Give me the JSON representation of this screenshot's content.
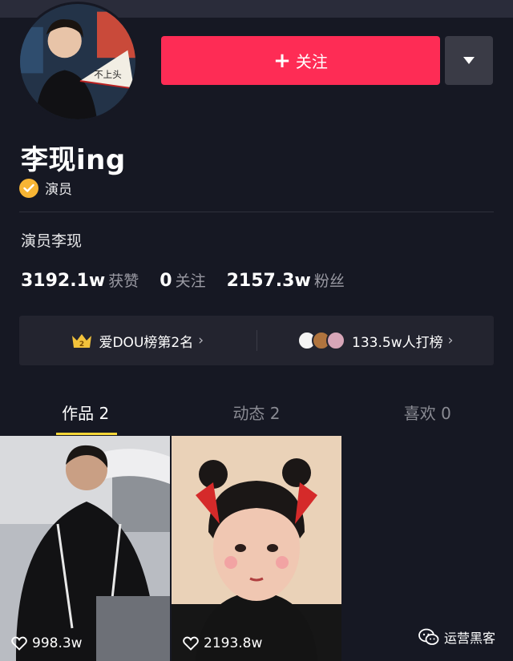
{
  "profile": {
    "username": "李现ing",
    "verify_label": "演员",
    "bio": "演员李现"
  },
  "actions": {
    "follow_label": "关注",
    "follow_icon": "plus-icon",
    "dropdown_icon": "triangle-down-icon"
  },
  "stats": [
    {
      "value": "3192.1w",
      "label": "获赞"
    },
    {
      "value": "0",
      "label": "关注"
    },
    {
      "value": "2157.3w",
      "label": "粉丝"
    }
  ],
  "rank": {
    "badge_number": "2",
    "left_text": "爱DOU榜第2名",
    "right_text": "133.5w人打榜",
    "chevron": "›"
  },
  "tabs": [
    {
      "label": "作品 2",
      "active": true
    },
    {
      "label": "动态 2",
      "active": false
    },
    {
      "label": "喜欢 0",
      "active": false
    }
  ],
  "videos": [
    {
      "likes": "998.3w"
    },
    {
      "likes": "2193.8w"
    }
  ],
  "watermark": {
    "text": "运营黑客",
    "icon": "wechat-icon"
  },
  "colors": {
    "background": "#161823",
    "follow": "#fe2c55",
    "tab_indicator": "#f7d637",
    "verify": "#f7b534"
  }
}
